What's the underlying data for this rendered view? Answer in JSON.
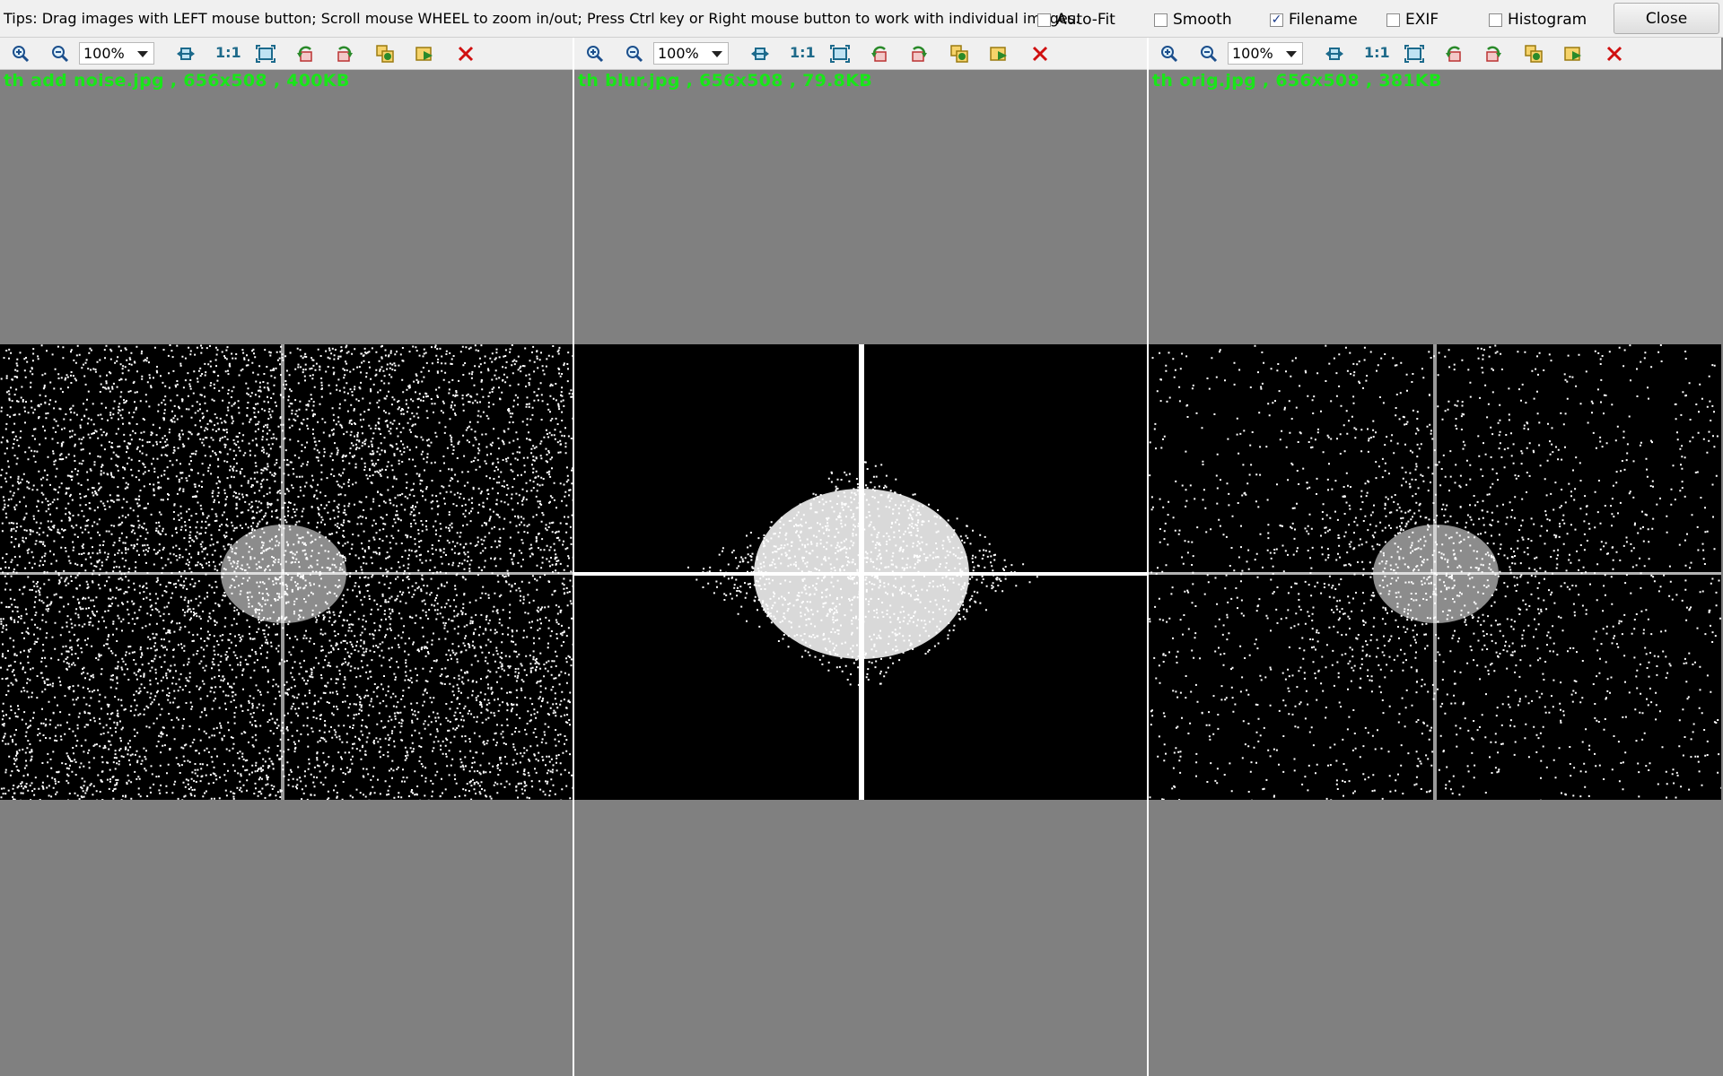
{
  "tips": "Tips: Drag images with LEFT mouse button; Scroll mouse WHEEL to zoom in/out; Press Ctrl key or Right mouse button to work with individual images.",
  "options": [
    {
      "label": "Auto-Fit",
      "checked": false
    },
    {
      "label": "Smooth",
      "checked": false
    },
    {
      "label": "Filename",
      "checked": true
    },
    {
      "label": "EXIF",
      "checked": false
    },
    {
      "label": "Histogram",
      "checked": false
    }
  ],
  "close_label": "Close",
  "panels": [
    {
      "zoom": "100%",
      "one_to_one": "1:1",
      "caption": "th add noise.jpg  ,  656x508  ,  400KB"
    },
    {
      "zoom": "100%",
      "one_to_one": "1:1",
      "caption": "th blur.jpg  ,  656x508  ,  79.8KB"
    },
    {
      "zoom": "100%",
      "one_to_one": "1:1",
      "caption": "th orig.jpg  ,  656x508  ,  381KB"
    }
  ],
  "toolbar_icons": [
    "zoom-in-icon",
    "zoom-out-icon",
    "fit-width-icon",
    "actual-size-icon",
    "fit-window-icon",
    "rotate-left-icon",
    "rotate-right-icon",
    "copy-icon",
    "save-icon",
    "close-image-icon"
  ]
}
